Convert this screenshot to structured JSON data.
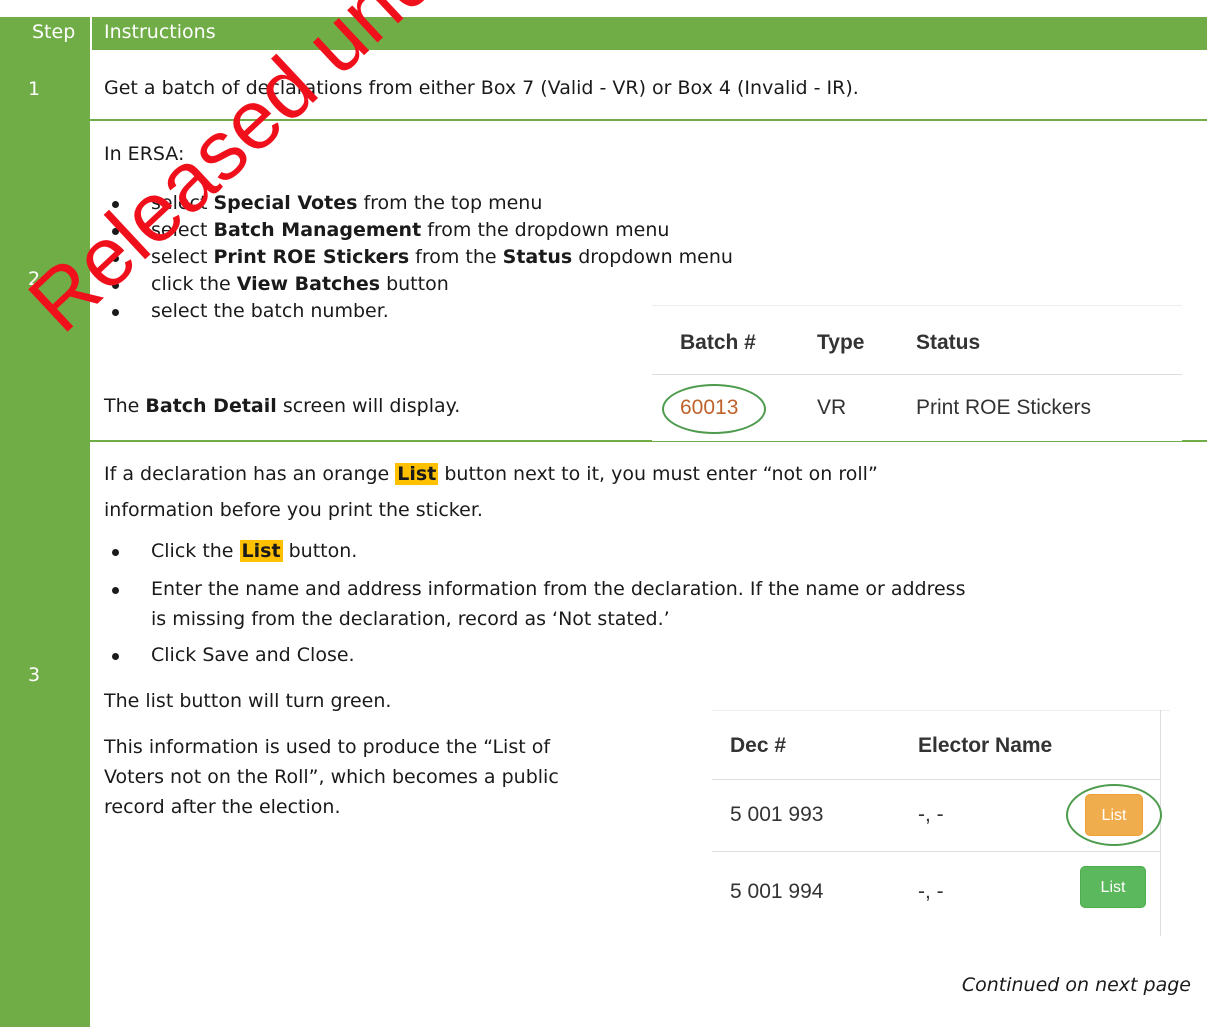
{
  "header": {
    "step": "Step",
    "instructions": "Instructions"
  },
  "steps": [
    {
      "number": "1",
      "text": "Get a batch of declarations from either Box 7 (Valid - VR) or Box 4 (Invalid - IR)."
    },
    {
      "number": "2",
      "intro": "In ERSA:",
      "bullets": [
        {
          "pre": "select ",
          "bold": "Special Votes",
          "post": " from the top menu"
        },
        {
          "pre": "select ",
          "bold": "Batch Management",
          "post": " from the dropdown menu"
        },
        {
          "pre": "select ",
          "bold": "Print ROE Stickers",
          "mid": " from the ",
          "bold2": "Status",
          "post": " dropdown menu"
        },
        {
          "pre": "click the ",
          "bold": "View Batches",
          "post": " button"
        },
        {
          "pre": "select the batch number.",
          "bold": "",
          "post": ""
        }
      ],
      "outro_pre": "The ",
      "outro_bold": "Batch Detail",
      "outro_post": " screen will display.",
      "screenshot": {
        "headers": [
          "Batch #",
          "Type",
          "Status"
        ],
        "row": [
          "60013",
          "VR",
          "Print ROE Stickers"
        ]
      }
    },
    {
      "number": "3",
      "intro_line1_pre": "If a declaration has an orange ",
      "intro_line1_hl": "List",
      "intro_line1_post": " button next to it, you must enter “not on roll”",
      "intro_line2": "information before you print the sticker.",
      "bullet1_pre": "Click the ",
      "bullet1_hl": "List",
      "bullet1_post": " button.",
      "bullet2_line1": "Enter the name and address information from the declaration. If the name or address",
      "bullet2_line2": "is missing from the declaration, record as ‘Not stated.’",
      "bullet3": "Click Save and Close.",
      "para1": "The list button will turn green.",
      "para2_line1": "This information is used to produce the “List of",
      "para2_line2": "Voters not on the Roll”, which becomes a public",
      "para2_line3": "record after the election.",
      "screenshot": {
        "headers": [
          "Dec #",
          "Elector Name"
        ],
        "rows": [
          {
            "dec": "5 001 993",
            "name": "-, -",
            "button": "List",
            "button_color": "#f0ad4e"
          },
          {
            "dec": "5 001 994",
            "name": "-, -",
            "button": "List",
            "button_color": "#5cb85c"
          }
        ]
      }
    }
  ],
  "continued": "Continued on next page",
  "watermark": "Released under the Official Information Act",
  "colors": {
    "accent_green": "#70ad47",
    "highlight": "#ffc000",
    "watermark": "#f0101c"
  }
}
